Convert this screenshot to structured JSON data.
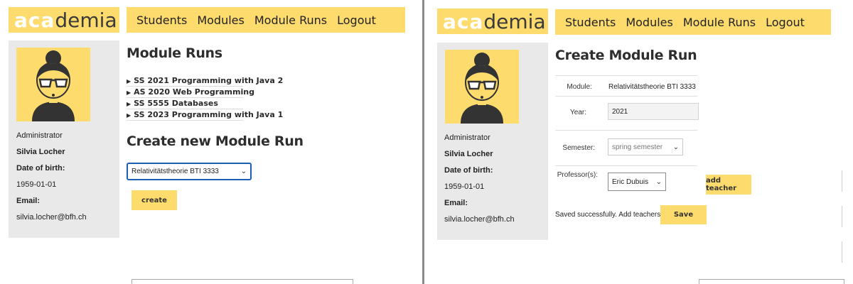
{
  "logo": {
    "part1": "aca",
    "part2": "demia"
  },
  "nav": [
    "Students",
    "Modules",
    "Module Runs",
    "Logout"
  ],
  "profile": {
    "role": "Administrator",
    "name": "Silvia Locher",
    "dob_label": "Date of birth:",
    "dob": "1959-01-01",
    "email_label": "Email:",
    "email": "silvia.locher@bfh.ch"
  },
  "left": {
    "title": "Module Runs",
    "runs": [
      "SS 2021 Programming with Java 2",
      "AS 2020 Web Programming",
      "SS 5555 Databases",
      "SS 2023 Programming with Java 1"
    ],
    "create_title": "Create new Module Run",
    "module_select": "Relativitätstheorie BTI 3333",
    "create_button": "create"
  },
  "right": {
    "title": "Create Module Run",
    "module_label": "Module:",
    "module_value": "Relativitätstheorie BTI 3333",
    "year_label": "Year:",
    "year_value": "2021",
    "semester_label": "Semester:",
    "semester_value": "spring semester",
    "professor_label": "Professor(s):",
    "professor_value": "Eric Dubuis",
    "add_teacher_button": "add teacher",
    "status_text": "Saved successfully. Add teachers",
    "save_button": "Save"
  },
  "colors": {
    "accent": "#fddb6d",
    "sidebar": "#e9e9e9",
    "focus": "#1a5fb4"
  },
  "icons": {
    "avatar": "woman-with-glasses-avatar",
    "select_arrow": "chevron-down-icon",
    "list_marker": "triangle-right-icon"
  }
}
